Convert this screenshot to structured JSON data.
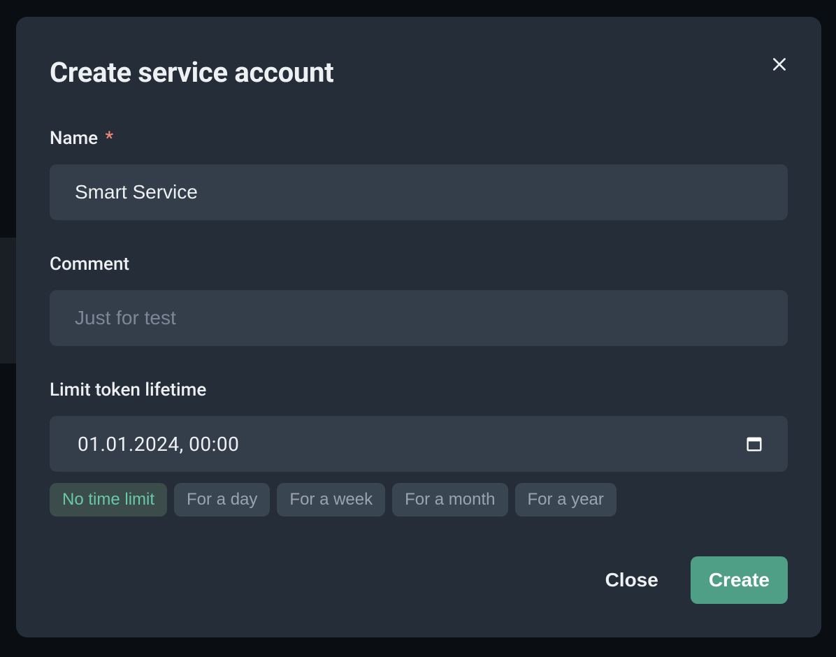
{
  "modal": {
    "title": "Create service account",
    "fields": {
      "name": {
        "label": "Name",
        "required_marker": "*",
        "value": "Smart Service"
      },
      "comment": {
        "label": "Comment",
        "placeholder": "Just for test",
        "value": ""
      },
      "lifetime": {
        "label": "Limit token lifetime",
        "datetime_value": "01.01.2024, 00:00",
        "presets": [
          {
            "label": "No time limit",
            "active": true
          },
          {
            "label": "For a day",
            "active": false
          },
          {
            "label": "For a week",
            "active": false
          },
          {
            "label": "For a month",
            "active": false
          },
          {
            "label": "For a year",
            "active": false
          }
        ]
      }
    },
    "footer": {
      "close_label": "Close",
      "create_label": "Create"
    }
  }
}
